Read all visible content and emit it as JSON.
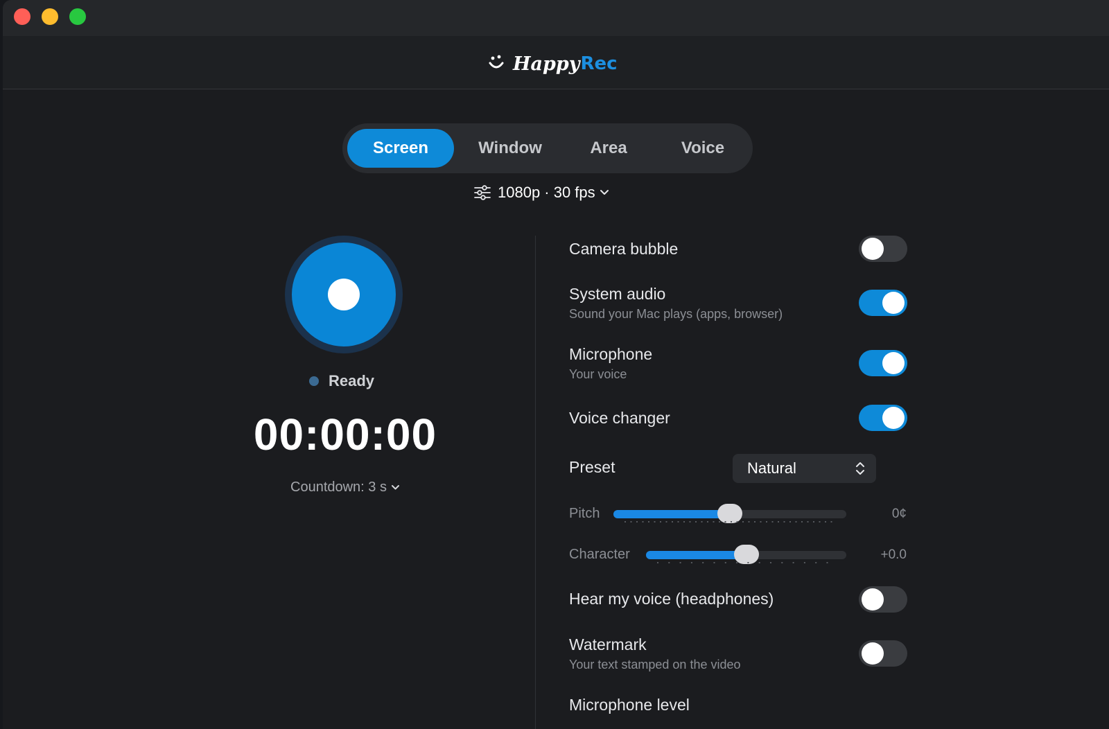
{
  "app": {
    "name_part1": "Happy",
    "name_part2": "Rec"
  },
  "tabs": [
    {
      "label": "Screen",
      "active": true
    },
    {
      "label": "Window",
      "active": false
    },
    {
      "label": "Area",
      "active": false
    },
    {
      "label": "Voice",
      "active": false
    }
  ],
  "quality": {
    "label": "1080p · 30 fps"
  },
  "recorder": {
    "status": "Ready",
    "timer": "00:00:00",
    "countdown": "Countdown: 3 s"
  },
  "settings": {
    "camera_bubble": {
      "label": "Camera bubble",
      "on": false
    },
    "system_audio": {
      "label": "System audio",
      "sub": "Sound your Mac plays (apps, browser)",
      "on": true
    },
    "microphone": {
      "label": "Microphone",
      "sub": "Your voice",
      "on": true
    },
    "voice_changer": {
      "label": "Voice changer",
      "on": true
    },
    "preset": {
      "label": "Preset",
      "value": "Natural"
    },
    "pitch": {
      "label": "Pitch",
      "value": "0¢",
      "fraction": 0.5
    },
    "character": {
      "label": "Character",
      "value": "+0.0",
      "fraction": 0.5
    },
    "hear_voice": {
      "label": "Hear my voice (headphones)",
      "on": false
    },
    "watermark": {
      "label": "Watermark",
      "sub": "Your text stamped on the video",
      "on": false
    },
    "mic_level": {
      "label": "Microphone level"
    }
  },
  "colors": {
    "accent": "#0e8ad8",
    "background": "#1b1c1f"
  }
}
